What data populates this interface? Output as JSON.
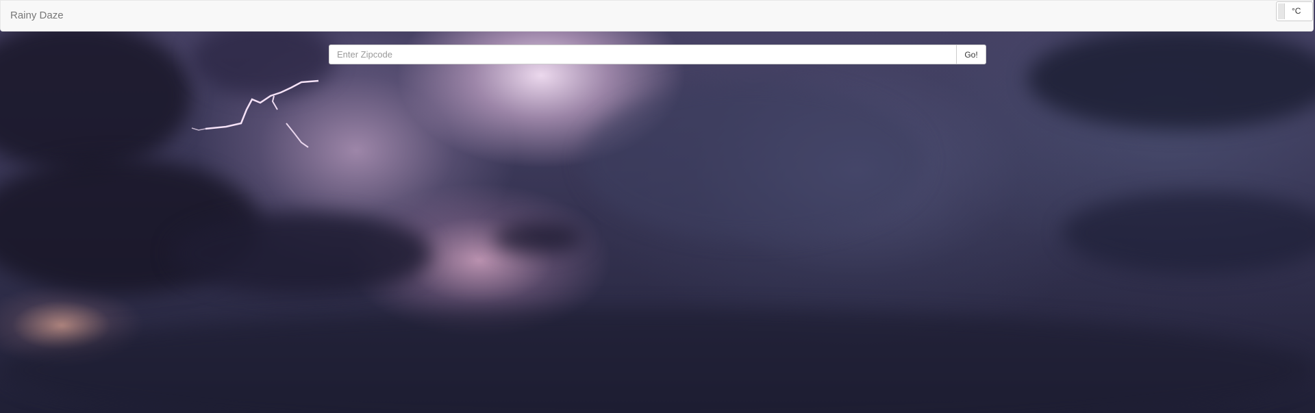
{
  "navbar": {
    "brand": "Rainy Daze",
    "unit_toggle_label": "°C"
  },
  "search": {
    "placeholder": "Enter Zipcode",
    "value": "",
    "button_label": "Go!"
  },
  "background": {
    "description_icon": "storm-clouds-lightning-background"
  }
}
